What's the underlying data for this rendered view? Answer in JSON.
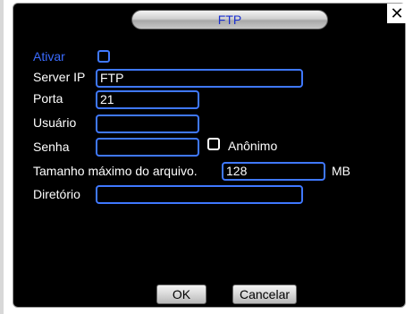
{
  "dialog": {
    "title": "FTP"
  },
  "form": {
    "ativar_label": "Ativar",
    "server_ip_label": "Server IP",
    "server_ip_value": "FTP",
    "porta_label": "Porta",
    "porta_value": "21",
    "usuario_label": "Usuário",
    "usuario_value": "",
    "senha_label": "Senha",
    "senha_value": "",
    "anonimo_label": "Anônimo",
    "max_size_label": "Tamanho máximo do arquivo.",
    "max_size_value": "128",
    "max_size_unit": "MB",
    "diretorio_label": "Diretório",
    "diretorio_value": ""
  },
  "buttons": {
    "ok_label": "OK",
    "cancel_label": "Cancelar"
  },
  "colors": {
    "accent": "#3f78ff",
    "title_text": "#1a2fd0",
    "background": "#000000"
  },
  "icons": {
    "close": "close-icon"
  }
}
